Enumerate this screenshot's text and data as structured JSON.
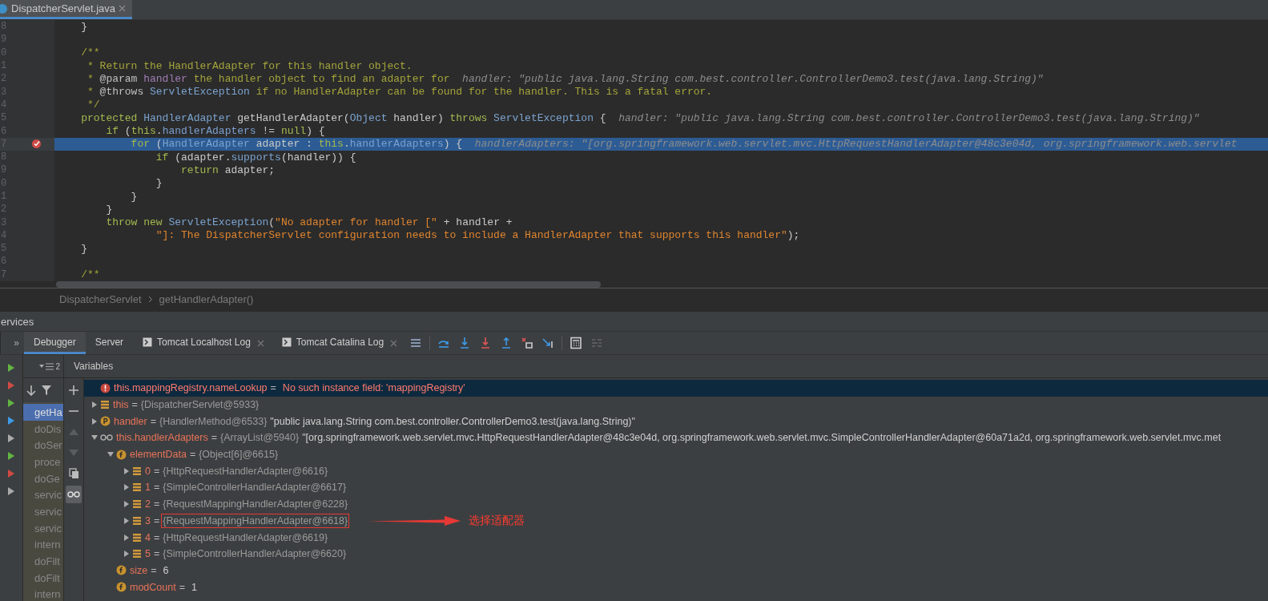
{
  "editor_tabs": [
    {
      "label": "DispatcherServlet.java",
      "selected": true
    }
  ],
  "code_lines": [
    {
      "number": "8",
      "breakpoint": false,
      "current": false,
      "tokens": [
        {
          "kind": "plain",
          "text": "    }"
        }
      ]
    },
    {
      "number": "9",
      "breakpoint": false,
      "current": false
    },
    {
      "number": "0",
      "breakpoint": false,
      "current": false,
      "tokens": [
        {
          "kind": "comment",
          "text": "    /**"
        }
      ]
    },
    {
      "number": "1",
      "breakpoint": false,
      "current": false,
      "tokens": [
        {
          "kind": "comment",
          "text": "     * Return the HandlerAdapter for this handler object."
        }
      ]
    },
    {
      "number": "2",
      "breakpoint": false,
      "current": false,
      "tokens": [
        {
          "kind": "comment",
          "text": "     * "
        },
        {
          "kind": "doctag",
          "text": "@param "
        },
        {
          "kind": "param",
          "text": "handler"
        },
        {
          "kind": "comment",
          "text": " the handler object to find an adapter for"
        },
        {
          "kind": "hint",
          "text": "  handler: \"public java.lang.String com.best.controller.ControllerDemo3.test(java.lang.String)\""
        }
      ]
    },
    {
      "number": "3",
      "breakpoint": false,
      "current": false,
      "tokens": [
        {
          "kind": "comment",
          "text": "     * "
        },
        {
          "kind": "doctag",
          "text": "@throws "
        },
        {
          "kind": "type",
          "text": "ServletException"
        },
        {
          "kind": "comment",
          "text": " if no HandlerAdapter can be found for the handler. This is a fatal error."
        }
      ]
    },
    {
      "number": "4",
      "breakpoint": false,
      "current": false,
      "tokens": [
        {
          "kind": "comment",
          "text": "     */"
        }
      ]
    },
    {
      "number": "5",
      "breakpoint": false,
      "current": false,
      "tokens": [
        {
          "kind": "kw",
          "text": "    protected "
        },
        {
          "kind": "type",
          "text": "HandlerAdapter"
        },
        {
          "kind": "plain",
          "text": " getHandlerAdapter("
        },
        {
          "kind": "type",
          "text": "Object"
        },
        {
          "kind": "plain",
          "text": " handler) "
        },
        {
          "kind": "kw",
          "text": "throws "
        },
        {
          "kind": "type",
          "text": "ServletException"
        },
        {
          "kind": "plain",
          "text": " {"
        },
        {
          "kind": "hint",
          "text": "  handler: \"public java.lang.String com.best.controller.ControllerDemo3.test(java.lang.String)\""
        }
      ]
    },
    {
      "number": "6",
      "breakpoint": false,
      "current": false,
      "tokens": [
        {
          "kind": "kw",
          "text": "        if"
        },
        {
          "kind": "plain",
          "text": " ("
        },
        {
          "kind": "kw",
          "text": "this"
        },
        {
          "kind": "plain",
          "text": "."
        },
        {
          "kind": "field",
          "text": "handlerAdapters"
        },
        {
          "kind": "plain",
          "text": " != "
        },
        {
          "kind": "kw",
          "text": "null"
        },
        {
          "kind": "plain",
          "text": ") {"
        }
      ]
    },
    {
      "number": "7",
      "breakpoint": true,
      "current": true,
      "tokens": [
        {
          "kind": "kw",
          "text": "            for"
        },
        {
          "kind": "plain",
          "text": " ("
        },
        {
          "kind": "type",
          "text": "HandlerAdapter"
        },
        {
          "kind": "plain",
          "text": " adapter : "
        },
        {
          "kind": "kw",
          "text": "this"
        },
        {
          "kind": "plain",
          "text": "."
        },
        {
          "kind": "field",
          "text": "handlerAdapters"
        },
        {
          "kind": "plain",
          "text": ") {"
        },
        {
          "kind": "hint",
          "text": "  handlerAdapters: \"[org.springframework.web.servlet.mvc.HttpRequestHandlerAdapter@48c3e04d, org.springframework.web.servlet"
        }
      ]
    },
    {
      "number": "8",
      "breakpoint": false,
      "current": false,
      "tokens": [
        {
          "kind": "kw",
          "text": "                if"
        },
        {
          "kind": "plain",
          "text": " (adapter."
        },
        {
          "kind": "method",
          "text": "supports"
        },
        {
          "kind": "plain",
          "text": "(handler)) {"
        }
      ]
    },
    {
      "number": "9",
      "breakpoint": false,
      "current": false,
      "tokens": [
        {
          "kind": "kw",
          "text": "                    return"
        },
        {
          "kind": "plain",
          "text": " adapter;"
        }
      ]
    },
    {
      "number": "0",
      "breakpoint": false,
      "current": false,
      "tokens": [
        {
          "kind": "plain",
          "text": "                }"
        }
      ]
    },
    {
      "number": "1",
      "breakpoint": false,
      "current": false,
      "tokens": [
        {
          "kind": "plain",
          "text": "            }"
        }
      ]
    },
    {
      "number": "2",
      "breakpoint": false,
      "current": false,
      "tokens": [
        {
          "kind": "plain",
          "text": "        }"
        }
      ]
    },
    {
      "number": "3",
      "breakpoint": false,
      "current": false,
      "tokens": [
        {
          "kind": "kw",
          "text": "        throw new "
        },
        {
          "kind": "type",
          "text": "ServletException"
        },
        {
          "kind": "plain",
          "text": "("
        },
        {
          "kind": "string",
          "text": "\"No adapter for handler [\""
        },
        {
          "kind": "plain",
          "text": " + handler +"
        }
      ]
    },
    {
      "number": "4",
      "breakpoint": false,
      "current": false,
      "tokens": [
        {
          "kind": "string",
          "text": "                \"]: The DispatcherServlet configuration needs to include a HandlerAdapter that supports this handler\""
        },
        {
          "kind": "plain",
          "text": ");"
        }
      ]
    },
    {
      "number": "5",
      "breakpoint": false,
      "current": false,
      "tokens": [
        {
          "kind": "plain",
          "text": "    }"
        }
      ]
    },
    {
      "number": "6",
      "breakpoint": false,
      "current": false
    },
    {
      "number": "7",
      "breakpoint": false,
      "current": false,
      "tokens": [
        {
          "kind": "comment",
          "text": "    /**"
        }
      ]
    }
  ],
  "breadcrumb": [
    "DispatcherServlet",
    "getHandlerAdapter()"
  ],
  "tool_window": {
    "title": "ervices"
  },
  "debug_tabs": {
    "overflow": "»",
    "tabs": [
      {
        "label": "Debugger",
        "selected": true,
        "kind": "plain",
        "closable": false
      },
      {
        "label": "Server",
        "selected": false,
        "kind": "plain",
        "closable": false
      },
      {
        "label": "Tomcat Localhost Log",
        "selected": false,
        "kind": "console",
        "closable": true
      },
      {
        "label": "Tomcat Catalina Log",
        "selected": false,
        "kind": "console",
        "closable": true
      }
    ]
  },
  "frames": {
    "thread_count": "2",
    "items": [
      {
        "label": "getHa",
        "selected": true
      },
      {
        "label": "doDis",
        "selected": false
      },
      {
        "label": "doSer",
        "selected": false
      },
      {
        "label": "proce",
        "selected": false
      },
      {
        "label": "doGe",
        "selected": false
      },
      {
        "label": "servic",
        "selected": false
      },
      {
        "label": "servic",
        "selected": false
      },
      {
        "label": "servic",
        "selected": false
      },
      {
        "label": "intern",
        "selected": false
      },
      {
        "label": "doFilt",
        "selected": false
      },
      {
        "label": "doFilt",
        "selected": false
      },
      {
        "label": "intern",
        "selected": false
      }
    ]
  },
  "variables": {
    "title": "Variables",
    "items": [
      {
        "kind": "error",
        "name": "this.mappingRegistry.nameLookup",
        "sep": "=",
        "value": "No such instance field: 'mappingRegistry'",
        "selected": true
      },
      {
        "kind": "list",
        "name": "this",
        "sep": "=",
        "ref": "{DispatcherServlet@5933}",
        "selected": false,
        "expanded": false
      },
      {
        "kind": "param",
        "name": "handler",
        "sep": "=",
        "ref": "{HandlerMethod@6533}",
        "value": "\"public java.lang.String com.best.controller.ControllerDemo3.test(java.lang.String)\"",
        "selected": false,
        "expanded": false
      },
      {
        "kind": "watch",
        "name": "this.handlerAdapters",
        "sep": "=",
        "ref": "{ArrayList@5940}",
        "value": "\"[org.springframework.web.servlet.mvc.HttpRequestHandlerAdapter@48c3e04d, org.springframework.web.servlet.mvc.SimpleControllerHandlerAdapter@60a71a2d, org.springframework.web.servlet.mvc.met",
        "selected": false,
        "expanded": true,
        "children": [
          {
            "kind": "field",
            "name": "elementData",
            "sep": "=",
            "ref": "{Object[6]@6615}",
            "selected": false,
            "expanded": true,
            "children": [
              {
                "kind": "list",
                "name": "0",
                "sep": "=",
                "ref": "{HttpRequestHandlerAdapter@6616}",
                "selected": false,
                "expanded": false,
                "boxed": false
              },
              {
                "kind": "list",
                "name": "1",
                "sep": "=",
                "ref": "{SimpleControllerHandlerAdapter@6617}",
                "selected": false,
                "expanded": false,
                "boxed": false
              },
              {
                "kind": "list",
                "name": "2",
                "sep": "=",
                "ref": "{RequestMappingHandlerAdapter@6228}",
                "selected": false,
                "expanded": false,
                "boxed": false
              },
              {
                "kind": "list",
                "name": "3",
                "sep": "=",
                "ref": "{RequestMappingHandlerAdapter@6618}",
                "selected": false,
                "expanded": false,
                "boxed": true,
                "note": "选择适配器"
              },
              {
                "kind": "list",
                "name": "4",
                "sep": "=",
                "ref": "{HttpRequestHandlerAdapter@6619}",
                "selected": false,
                "expanded": false,
                "boxed": false
              },
              {
                "kind": "list",
                "name": "5",
                "sep": "=",
                "ref": "{SimpleControllerHandlerAdapter@6620}",
                "selected": false,
                "expanded": false,
                "boxed": false
              }
            ]
          },
          {
            "kind": "field",
            "name": "size",
            "sep": "=",
            "value": "6",
            "selected": false
          },
          {
            "kind": "field",
            "name": "modCount",
            "sep": "=",
            "value": "1",
            "selected": false
          }
        ]
      }
    ]
  }
}
